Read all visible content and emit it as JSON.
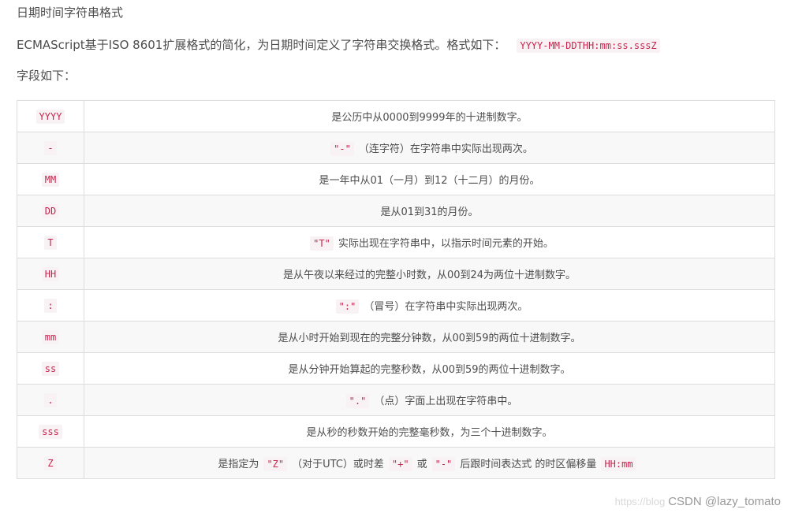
{
  "heading": "日期时间字符串格式",
  "intro": {
    "text": "ECMAScript基于ISO 8601扩展格式的简化，为日期时间定义了字符串交换格式。格式如下：",
    "format": "YYYY-MM-DDTHH:mm:ss.sssZ"
  },
  "fields_label": "字段如下：",
  "rows": [
    {
      "key": "YYYY",
      "parts": [
        "是公历中从0000到9999年的十进制数字。"
      ]
    },
    {
      "key": "-",
      "parts": [
        "\"-\"",
        "（连字符）在字符串中实际出现两次。"
      ]
    },
    {
      "key": "MM",
      "parts": [
        "是一年中从01（一月）到12（十二月）的月份。"
      ]
    },
    {
      "key": "DD",
      "parts": [
        "是从01到31的月份。"
      ]
    },
    {
      "key": "T",
      "parts": [
        "\"T\"",
        "实际出现在字符串中，以指示时间元素的开始。"
      ]
    },
    {
      "key": "HH",
      "parts": [
        "是从午夜以来经过的完整小时数，从00到24为两位十进制数字。"
      ]
    },
    {
      "key": ":",
      "parts": [
        "\":\"",
        "（冒号）在字符串中实际出现两次。"
      ]
    },
    {
      "key": "mm",
      "parts": [
        "是从小时开始到现在的完整分钟数，从00到59的两位十进制数字。"
      ]
    },
    {
      "key": "ss",
      "parts": [
        "是从分钟开始算起的完整秒数，从00到59的两位十进制数字。"
      ]
    },
    {
      "key": ".",
      "parts": [
        "\".\"",
        "（点）字面上出现在字符串中。"
      ]
    },
    {
      "key": "sss",
      "parts": [
        "是从秒的秒数开始的完整毫秒数，为三个十进制数字。"
      ]
    },
    {
      "key": "Z",
      "parts": [
        "是指定为",
        "\"Z\"",
        "（对于UTC）或时差",
        "\"+\"",
        "或",
        "\"-\"",
        "后跟时间表达式 的时区偏移量",
        "HH:mm"
      ]
    }
  ],
  "watermark": {
    "faint": "https://blog",
    "text": "CSDN @lazy_tomato"
  }
}
